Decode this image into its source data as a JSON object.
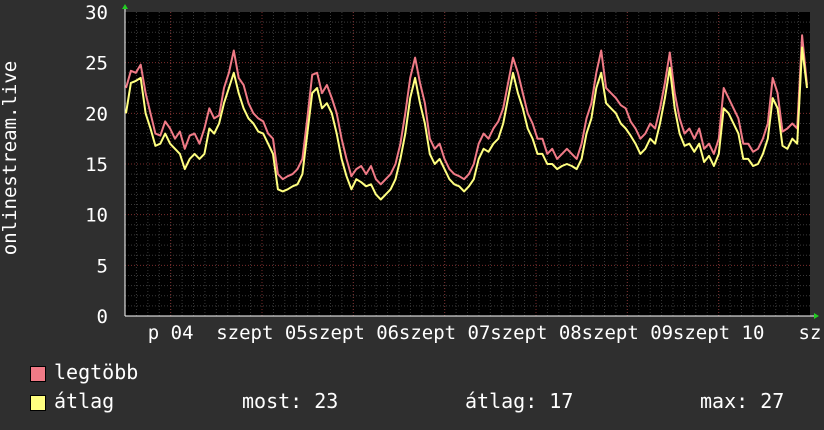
{
  "chart_data": {
    "type": "line",
    "ylabel": "onlinestream.live",
    "ylim": [
      0,
      30
    ],
    "yticks": [
      "0",
      "5",
      "10",
      "15",
      "20",
      "25",
      "30"
    ],
    "xtick_labels": [
      "p 04",
      "szept 05",
      "szept 06",
      "szept 07",
      "szept 08",
      "szept 09",
      "szept 10",
      "sz"
    ],
    "grid": true,
    "colors": {
      "legtobb": "#f07a86",
      "atlag": "#ffff80",
      "background": "#000000",
      "grid_minor": "#3a3a3a",
      "grid_major": "#7a2d2d",
      "page": "#2f2f2f"
    },
    "series": [
      {
        "name": "legtöbb",
        "values": [
          22.5,
          24.2,
          24.0,
          24.8,
          22.0,
          20.0,
          18.0,
          17.8,
          19.2,
          18.5,
          17.5,
          18.2,
          16.5,
          17.8,
          18.0,
          17.0,
          18.5,
          20.5,
          19.5,
          19.8,
          22.5,
          24.0,
          26.2,
          23.5,
          22.8,
          21.0,
          20.0,
          19.5,
          19.2,
          18.0,
          17.5,
          14.0,
          13.5,
          13.8,
          14.0,
          14.5,
          15.5,
          19.5,
          23.8,
          24.0,
          22.0,
          22.8,
          21.5,
          20.0,
          17.5,
          15.5,
          13.8,
          14.5,
          14.8,
          14.0,
          14.8,
          13.5,
          13.0,
          13.5,
          14.0,
          15.0,
          17.0,
          20.0,
          23.5,
          25.5,
          23.0,
          21.0,
          17.5,
          16.5,
          17.0,
          15.5,
          14.5,
          14.0,
          13.8,
          13.5,
          14.0,
          15.0,
          17.0,
          18.0,
          17.5,
          18.5,
          19.2,
          20.5,
          23.0,
          25.5,
          24.0,
          22.0,
          20.0,
          19.0,
          17.5,
          17.5,
          16.0,
          16.5,
          15.5,
          16.0,
          16.5,
          16.0,
          15.5,
          17.0,
          19.5,
          21.0,
          24.0,
          26.2,
          22.5,
          22.0,
          21.5,
          20.8,
          20.5,
          19.2,
          18.5,
          17.5,
          18.0,
          19.0,
          18.5,
          20.5,
          23.0,
          26.0,
          22.0,
          19.5,
          18.0,
          18.5,
          17.5,
          18.5,
          16.5,
          17.0,
          16.0,
          17.5,
          22.5,
          21.5,
          20.5,
          19.5,
          17.0,
          17.0,
          16.2,
          16.5,
          17.5,
          19.0,
          23.5,
          22.0,
          18.2,
          18.5,
          19.0,
          18.5,
          27.7,
          22.8
        ]
      },
      {
        "name": "átlag",
        "values": [
          20.0,
          23.0,
          23.2,
          23.5,
          20.0,
          18.5,
          16.8,
          17.0,
          18.0,
          17.0,
          16.5,
          16.0,
          14.5,
          15.5,
          16.0,
          15.5,
          16.0,
          18.5,
          18.0,
          19.0,
          21.0,
          22.5,
          24.0,
          22.0,
          20.5,
          19.5,
          19.0,
          18.2,
          18.0,
          17.0,
          16.0,
          12.5,
          12.3,
          12.5,
          12.8,
          13.0,
          14.0,
          18.0,
          22.0,
          22.5,
          20.5,
          21.0,
          20.0,
          18.0,
          15.5,
          13.8,
          12.5,
          13.5,
          13.2,
          12.8,
          13.0,
          12.0,
          11.5,
          12.0,
          12.5,
          13.5,
          15.5,
          18.0,
          21.5,
          23.5,
          21.0,
          19.0,
          16.0,
          15.0,
          15.5,
          14.5,
          13.5,
          13.0,
          12.8,
          12.3,
          12.8,
          13.5,
          15.5,
          16.5,
          16.2,
          17.0,
          17.5,
          19.0,
          21.5,
          24.0,
          22.0,
          20.5,
          18.5,
          17.5,
          16.0,
          16.0,
          15.0,
          15.0,
          14.5,
          14.8,
          15.0,
          14.8,
          14.5,
          15.5,
          18.0,
          19.5,
          22.5,
          24.0,
          21.0,
          20.5,
          20.0,
          19.0,
          18.5,
          17.8,
          17.0,
          16.0,
          16.5,
          17.5,
          17.0,
          19.0,
          21.5,
          24.5,
          20.5,
          18.0,
          16.8,
          17.0,
          16.2,
          17.0,
          15.2,
          15.8,
          14.8,
          16.0,
          20.5,
          20.0,
          19.0,
          18.0,
          15.5,
          15.5,
          14.8,
          15.0,
          16.0,
          17.5,
          21.5,
          20.5,
          16.8,
          16.5,
          17.5,
          17.0,
          26.5,
          22.5
        ]
      }
    ]
  },
  "legend": {
    "max_label": "legtöbb",
    "avg_label": "átlag",
    "stats": {
      "now": "most: 23",
      "avg": "átlag: 17",
      "max": "max: 27"
    }
  }
}
